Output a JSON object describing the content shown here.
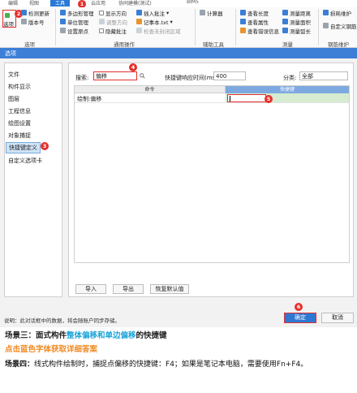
{
  "ribbon": {
    "tabs": [
      "编辑",
      "视图",
      "工具",
      "云应用",
      "协同建模(测试)",
      "BIM5"
    ],
    "active_tab_index": 2,
    "tab_visible_partial": [
      true,
      true,
      true,
      true,
      true,
      true
    ],
    "groups": {
      "options": {
        "label": "选项",
        "items": [
          "选项",
          "检测更新",
          "版本号"
        ]
      },
      "common": {
        "label": "通用操作",
        "items": [
          "多边形管理",
          "显示方向",
          "插入批注",
          "单位管理",
          "调整方向",
          "记事本.txt",
          "设置原点",
          "隐藏批注",
          "检查未封闭区域"
        ]
      },
      "aux": {
        "label": "辅助工具",
        "items": [
          "计算器"
        ]
      },
      "measure": {
        "label": "测量",
        "items": [
          "查看长度",
          "测量距离",
          "查看属性",
          "测量面积",
          "查看错误信息",
          "测量弧长"
        ]
      },
      "rebar": {
        "label": "钢筋维护",
        "items": [
          "损耗维护",
          "自定义钢筋"
        ]
      }
    }
  },
  "dialog": {
    "title": "选项",
    "nav_items": [
      "文件",
      "构件显示",
      "图层",
      "工程信息",
      "绘图设置",
      "对象捕捉",
      "快捷键定义",
      "自定义选项卡"
    ],
    "active_nav_index": 6,
    "search": {
      "label": "搜索:",
      "value": "偏移"
    },
    "delay": {
      "label": "快捷键响应时间(ms):",
      "value": "400"
    },
    "category": {
      "label": "分类:",
      "value": "全部"
    },
    "grid": {
      "col_command": "命令",
      "col_shortcut": "快捷键",
      "rows": [
        {
          "command": "绘制:偏移",
          "shortcut": ""
        }
      ]
    },
    "buttons": {
      "import": "导入",
      "export": "导出",
      "restore": "恢复默认值",
      "ok": "确定",
      "cancel": "取消"
    },
    "footer_note": "说明：此对话框中的数据，将会随账户同步存储。"
  },
  "markers": [
    "1",
    "2",
    "3",
    "4",
    "5",
    "6"
  ],
  "article": {
    "scene3_prefix": "场景三：面式构件",
    "scene3_highlight": "整体偏移和单边偏移",
    "scene3_suffix": "的快捷键",
    "link_text": "点击蓝色字体获取详细答案",
    "scene4_label": "场景四：",
    "scene4_text": "线式构件绘制时，捕捉点偏移的快捷键：F4；如果是笔记本电脑，需要使用Fn+F4。"
  }
}
